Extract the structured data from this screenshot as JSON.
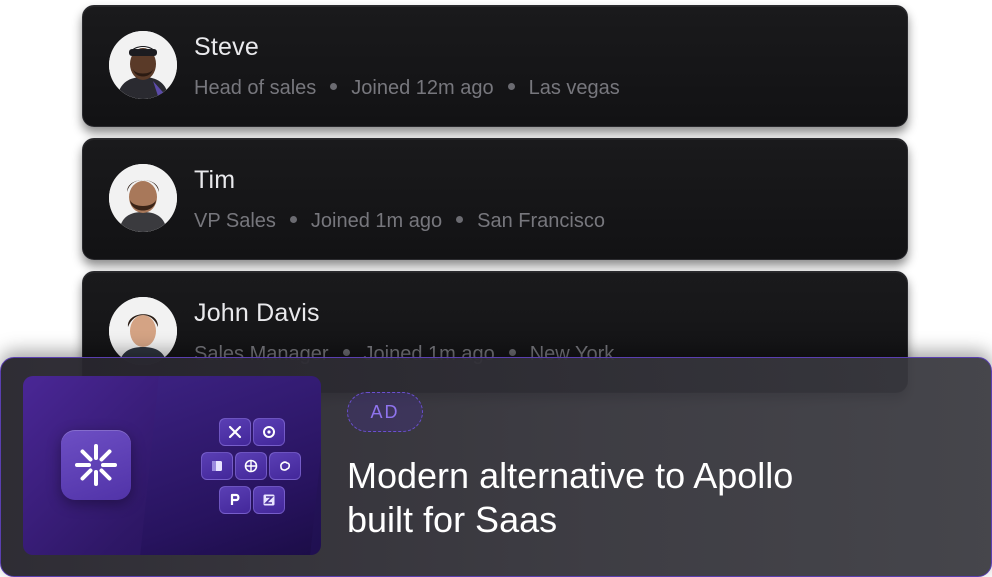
{
  "people": [
    {
      "name": "Steve",
      "role": "Head of sales",
      "joined": "Joined 12m ago",
      "location": "Las vegas"
    },
    {
      "name": "Tim",
      "role": "VP Sales",
      "joined": "Joined 1m ago",
      "location": "San Francisco"
    },
    {
      "name": "John Davis",
      "role": "Sales Manager",
      "joined": "Joined 1m ago",
      "location": "New York"
    }
  ],
  "ad": {
    "badge": "AD",
    "title_line1": "Modern alternative to Apollo",
    "title_line2": "built for Saas"
  },
  "colors": {
    "card_background": "#151517",
    "accent_purple": "#5a3fb0",
    "text_primary": "#e9e9ec",
    "text_secondary": "#77777d"
  },
  "icons": [
    "avatar-steve",
    "avatar-tim",
    "avatar-john",
    "sparkle-logo-icon",
    "integration-icons"
  ]
}
